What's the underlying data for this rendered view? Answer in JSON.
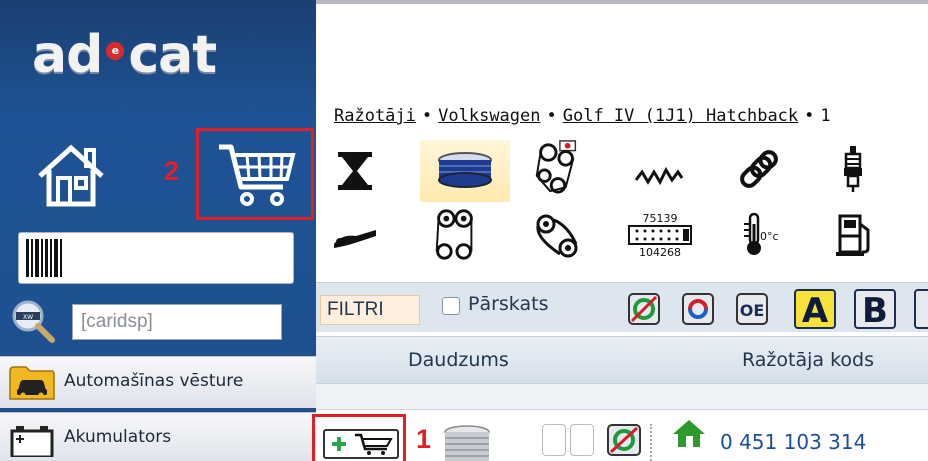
{
  "logo": {
    "part1": "ad",
    "dot": "e",
    "part2": "cat"
  },
  "annotations": {
    "cart_number": "2",
    "add_cart_number": "1"
  },
  "sidebar": {
    "search_placeholder": "[caridsp]",
    "items": [
      {
        "label": "Automašīnas vēsture",
        "icon": "car-history-icon"
      },
      {
        "label": "Akumulators",
        "icon": "battery-icon"
      }
    ]
  },
  "breadcrumb": {
    "items": [
      "Ražotāji",
      "Volkswagen",
      "Golf IV (1J1) Hatchback",
      "1"
    ],
    "separator": "•"
  },
  "categories_row1": [
    "hourglass-icon",
    "air-filter-icon",
    "timing-belt-kit-icon",
    "sensor-wave-icon",
    "chain-icon",
    "spark-plug-icon"
  ],
  "categories_row2": [
    "wiper-icon",
    "belt-pulley-icon",
    "v-belt-icon",
    "ignition-order-icon",
    "temperature-sensor-icon",
    "fuel-pump-icon"
  ],
  "ignition_order": {
    "top": "75139",
    "bottom": "104268"
  },
  "temp_label": "0°c",
  "filter_bar": {
    "filtri_label": "FILTRI",
    "overview_label": "Pārskats",
    "oe_label": "OE",
    "letter_a": "A",
    "letter_b": "B"
  },
  "table": {
    "columns": [
      "Daudzums",
      "Ražotāja kods"
    ]
  },
  "result_row": {
    "part_code": "0 451 103 314"
  },
  "colors": {
    "sidebar_bg": "#1f5395",
    "annotation_red": "#e01f26",
    "letter_a_bg": "#f5e23a",
    "code_blue": "#1a4f9a"
  }
}
